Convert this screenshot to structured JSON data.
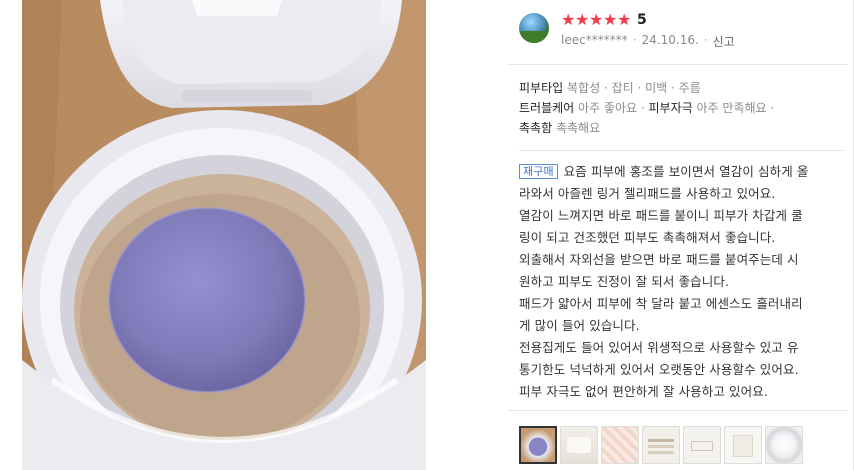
{
  "review": {
    "rating": "5",
    "stars_total": 5,
    "stars_filled": 5,
    "user": "leec*******",
    "date": "24.10.16.",
    "report_label": "신고",
    "attributes": [
      {
        "key": "피부타입",
        "value": "복합성 · 잡티 · 미백 · 주름"
      },
      {
        "key": "트러블케어",
        "value": "아주 좋아요 ·",
        "key2": "피부자극",
        "value2": "아주 만족해요 ·"
      },
      {
        "key": "촉촉함",
        "value": "촉촉해요"
      }
    ],
    "badge": "재구매",
    "lines": [
      "요즘 피부에 홍조를 보이면서 열감이 심하게 올",
      "라와서 아즐렌 링거 젤리패드를 사용하고 있어요.",
      "열감이 느껴지면 바로 패드를 붙이니 피부가 차갑게 쿨",
      "링이 되고 건조했던 피부도 촉촉해져서 좋습니다.",
      "외출해서 자외선을 받으면 바로 패드를 붙여주는데 시",
      "원하고 피부도 진정이 잘 되서 좋습니다.",
      "패드가 얇아서 피부에 착 달라 붙고 에센스도 흘러내리",
      "게 많이 들어 있습니다.",
      "전용집게도 들어 있어서 위생적으로 사용할수 있고 유",
      "통기한도 넉넉하게 있어서 오랫동안 사용할수 있어요.",
      "피부 자극도 없어 편안하게 잘 사용하고 있어요."
    ],
    "thumbnail_count": 7,
    "selected_thumbnail": 1
  },
  "colors": {
    "star": "#f03c4b",
    "badge": "#3a77d0",
    "muted": "#8b8b8b"
  }
}
